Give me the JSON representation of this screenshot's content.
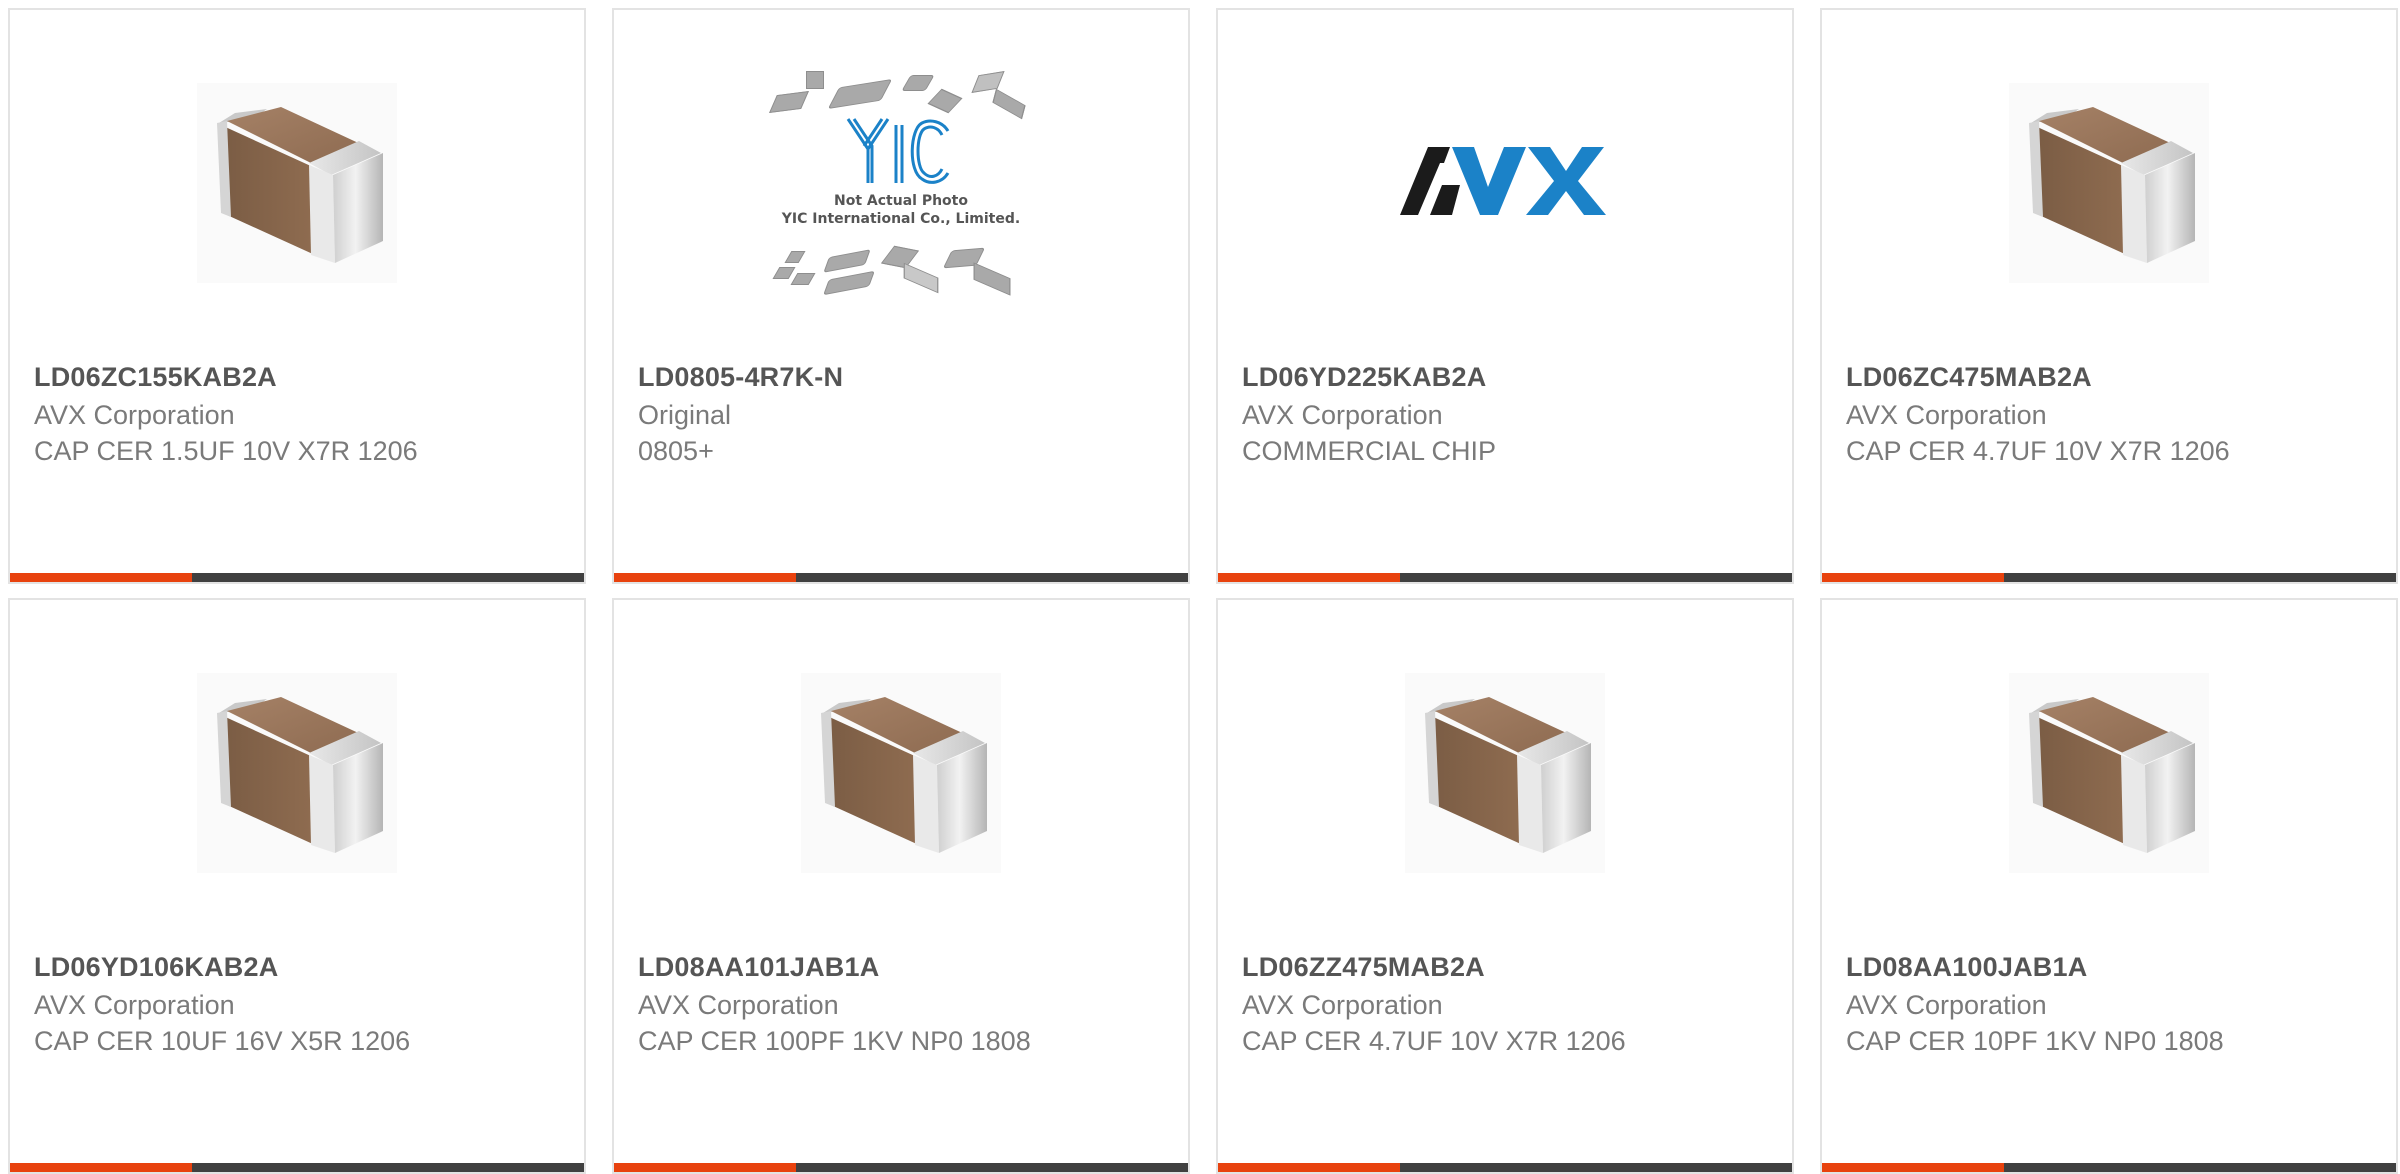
{
  "cards": [
    {
      "part": "LD06ZC155KAB2A",
      "manufacturer": "AVX Corporation",
      "description": "CAP CER 1.5UF 10V X7R 1206",
      "image": "capacitor-chip"
    },
    {
      "part": "LD0805-4R7K-N",
      "manufacturer": "Original",
      "description": "0805+",
      "image": "yic-not-actual-photo",
      "image_text": {
        "logo": "YIC",
        "line1": "Not Actual Photo",
        "line2": "YIC International Co., Limited."
      }
    },
    {
      "part": "LD06YD225KAB2A",
      "manufacturer": "AVX Corporation",
      "description": "COMMERCIAL CHIP",
      "image": "avx-logo",
      "image_text": {
        "logo": "AVX"
      }
    },
    {
      "part": "LD06ZC475MAB2A",
      "manufacturer": "AVX Corporation",
      "description": "CAP CER 4.7UF 10V X7R 1206",
      "image": "capacitor-chip"
    },
    {
      "part": "LD06YD106KAB2A",
      "manufacturer": "AVX Corporation",
      "description": "CAP CER 10UF 16V X5R 1206",
      "image": "capacitor-chip"
    },
    {
      "part": "LD08AA101JAB1A",
      "manufacturer": "AVX Corporation",
      "description": "CAP CER 100PF 1KV NP0 1808",
      "image": "capacitor-chip"
    },
    {
      "part": "LD06ZZ475MAB2A",
      "manufacturer": "AVX Corporation",
      "description": "CAP CER 4.7UF 10V X7R 1206",
      "image": "capacitor-chip"
    },
    {
      "part": "LD08AA100JAB1A",
      "manufacturer": "AVX Corporation",
      "description": "CAP CER 10PF 1KV NP0 1808",
      "image": "capacitor-chip"
    }
  ],
  "colors": {
    "accent": "#e8420e",
    "bar_dark": "#404040",
    "part_text": "#555555",
    "secondary_text": "#7a7a7a",
    "avx_dark": "#1b1b1b",
    "avx_blue": "#1b82c8"
  }
}
